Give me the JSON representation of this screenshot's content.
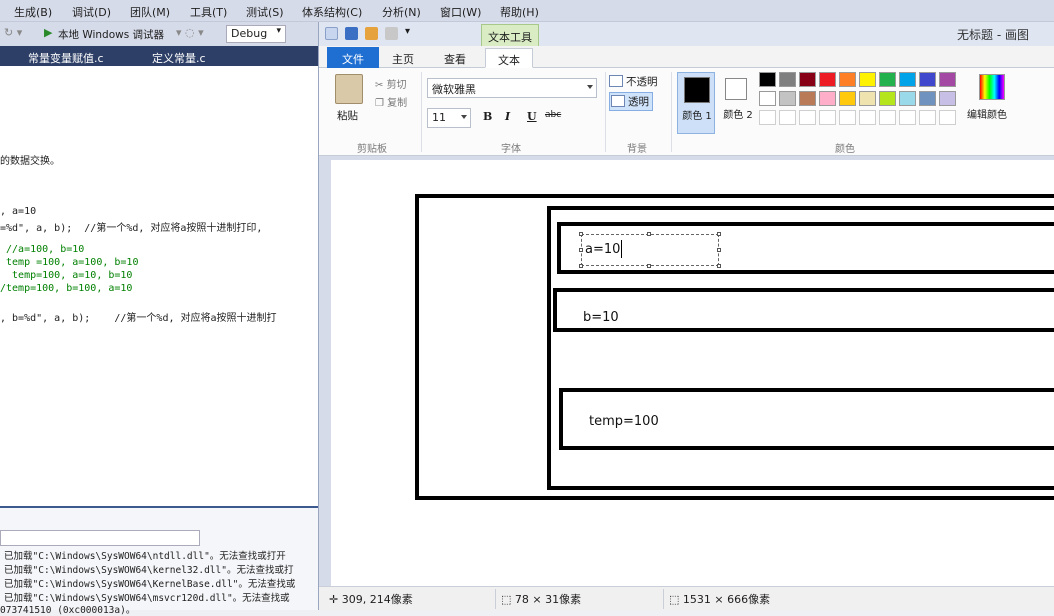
{
  "vs": {
    "menu": [
      "生成(B)",
      "调试(D)",
      "团队(M)",
      "工具(T)",
      "测试(S)",
      "体系结构(C)",
      "分析(N)",
      "窗口(W)",
      "帮助(H)"
    ],
    "toolbar": {
      "debugger": "本地 Windows 调试器",
      "config": "Debug"
    },
    "tabs": [
      "常量变量赋值.c",
      "定义常量.c"
    ],
    "code": [
      "的数据交换。",
      ", a=10",
      "=%d\", a, b);  //第一个%d, 对应将a按照十进制打印,",
      " //a=100, b=10",
      " temp =100, a=100, b=10",
      "  temp=100, a=10, b=10",
      "/temp=100, b=100, a=10",
      ", b=%d\", a, b);    //第一个%d, 对应将a按照十进制打"
    ],
    "output": [
      "已加载\"C:\\Windows\\SysWOW64\\ntdll.dll\"。无法查找或打开",
      "已加载\"C:\\Windows\\SysWOW64\\kernel32.dll\"。无法查找或打",
      "已加载\"C:\\Windows\\SysWOW64\\KernelBase.dll\"。无法查找或",
      "已加载\"C:\\Windows\\SysWOW64\\msvcr120d.dll\"。无法查找或",
      "073741510 (0xc000013a)。"
    ]
  },
  "paint": {
    "title": "无标题 - 画图",
    "context_tab": "文本工具",
    "tabs": {
      "file": "文件",
      "home": "主页",
      "view": "查看",
      "text": "文本"
    },
    "clipboard": {
      "paste": "粘贴",
      "cut": "剪切",
      "copy": "复制",
      "label": "剪贴板"
    },
    "font": {
      "name": "微软雅黑",
      "size": "11",
      "label": "字体",
      "strike": "abc"
    },
    "background": {
      "opaque": "不透明",
      "transparent": "透明",
      "label": "背景"
    },
    "colors": {
      "color1_label": "颜色 1",
      "color2_label": "颜色 2",
      "edit_label": "编辑颜色",
      "group_label": "颜色",
      "color1": "#000000",
      "color2": "#ffffff",
      "palette_row1": [
        "#000000",
        "#7f7f7f",
        "#880015",
        "#ed1c24",
        "#ff7f27",
        "#fff200",
        "#22b14c",
        "#00a2e8",
        "#3f48cc",
        "#a349a4"
      ],
      "palette_row2": [
        "#ffffff",
        "#c3c3c3",
        "#b97a57",
        "#ffaec9",
        "#ffc90e",
        "#efe4b0",
        "#b5e61d",
        "#99d9ea",
        "#7092be",
        "#c8bfe7"
      ]
    },
    "canvas": {
      "texts": [
        "a=10",
        "b=10",
        "temp=100"
      ]
    },
    "status": {
      "cursor": "309, 214像素",
      "selection": "78 × 31像素",
      "size": "1531 × 666像素"
    }
  }
}
